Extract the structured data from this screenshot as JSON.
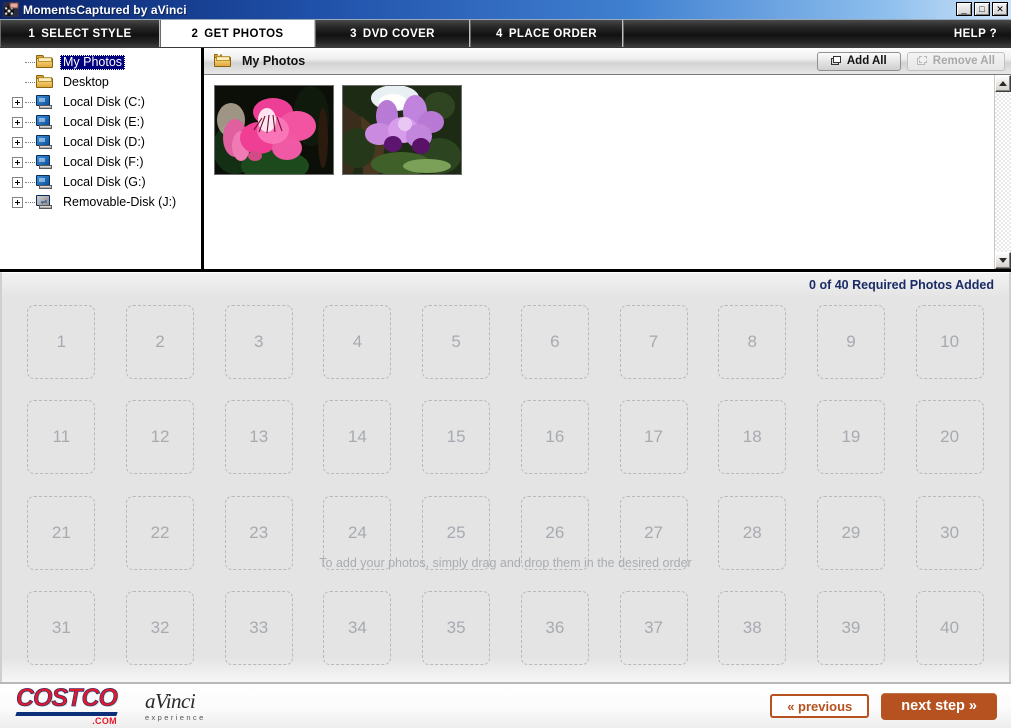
{
  "window": {
    "title": "MomentsCaptured by aVinci",
    "icon": "film-reel-icon",
    "minimize": "_",
    "maximize": "□",
    "close": "✕"
  },
  "tabs": [
    {
      "num": "1",
      "label": "SELECT STYLE",
      "active": false
    },
    {
      "num": "2",
      "label": "GET PHOTOS",
      "active": true
    },
    {
      "num": "3",
      "label": "DVD COVER",
      "active": false
    },
    {
      "num": "4",
      "label": "PLACE ORDER",
      "active": false
    }
  ],
  "help_label": "HELP ?",
  "tree": {
    "items": [
      {
        "label": "My Photos",
        "icon": "folder-icon",
        "expander": false,
        "selected": true,
        "indent": 1
      },
      {
        "label": "Desktop",
        "icon": "folder-icon",
        "expander": false,
        "selected": false,
        "indent": 1
      },
      {
        "label": "Local Disk (C:)",
        "icon": "drive-icon",
        "expander": true,
        "selected": false,
        "indent": 0
      },
      {
        "label": "Local Disk (E:)",
        "icon": "drive-icon",
        "expander": true,
        "selected": false,
        "indent": 0
      },
      {
        "label": "Local Disk (D:)",
        "icon": "drive-icon",
        "expander": true,
        "selected": false,
        "indent": 0
      },
      {
        "label": "Local Disk (F:)",
        "icon": "drive-icon",
        "expander": true,
        "selected": false,
        "indent": 0
      },
      {
        "label": "Local Disk (G:)",
        "icon": "drive-icon",
        "expander": true,
        "selected": false,
        "indent": 0
      },
      {
        "label": "Removable-Disk (J:)",
        "icon": "removable-drive-icon",
        "expander": true,
        "selected": false,
        "indent": 0
      }
    ]
  },
  "photo_panel": {
    "folder_icon": "folder-icon",
    "title": "My Photos",
    "add_all_label": "Add All",
    "remove_all_label": "Remove All",
    "remove_all_disabled": true,
    "thumbnails": [
      {
        "name": "pink-alstroemeria-flower"
      },
      {
        "name": "purple-orchid-flowers"
      }
    ]
  },
  "order_grid": {
    "status": "0 of 40 Required Photos Added",
    "status_color": "#1b2b66",
    "hint": "To add your photos, simply drag and drop them in the desired order",
    "slots": [
      "1",
      "2",
      "3",
      "4",
      "5",
      "6",
      "7",
      "8",
      "9",
      "10",
      "11",
      "12",
      "13",
      "14",
      "15",
      "16",
      "17",
      "18",
      "19",
      "20",
      "21",
      "22",
      "23",
      "24",
      "25",
      "26",
      "27",
      "28",
      "29",
      "30",
      "31",
      "32",
      "33",
      "34",
      "35",
      "36",
      "37",
      "38",
      "39",
      "40"
    ]
  },
  "footer": {
    "costco_word": "COSTCO",
    "costco_dot": ".COM",
    "avinci_word": "aVinci",
    "avinci_sub": "experience",
    "previous_label": "« previous",
    "next_label": "next step »",
    "accent_color": "#b5521f"
  }
}
